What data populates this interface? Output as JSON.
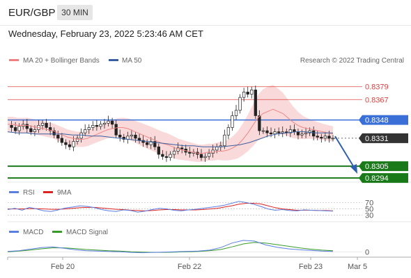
{
  "header": {
    "pair": "EUR/GBP",
    "timeframe": "30 MIN",
    "datetime": "Wednesday, February 23, 2022 5:23:46 AM CET"
  },
  "legend": {
    "ma20": "MA 20 + Bollinger Bands",
    "ma50": "MA 50",
    "credit": "Research © 2022 Trading Central"
  },
  "colors": {
    "resistance": "#d44",
    "pivot": "#3a6fd8",
    "support": "#1a7a1a",
    "price": "#333333",
    "bollinger": "#f6c9c9",
    "ma20": "#e88",
    "ma50": "#3a5fa0",
    "rsi": "#5a7de0",
    "rsi_ma": "#d22",
    "macd": "#5a7de0",
    "macd_signal": "#3a9a2a",
    "arrow": "#2d5fb0"
  },
  "chart_data": [
    {
      "type": "candlestick",
      "title": "EUR/GBP 30 MIN",
      "x_tick_labels": [
        "Feb 20",
        "Feb 22",
        "Feb 23",
        "Mar 5"
      ],
      "ylim": [
        0.8285,
        0.8395
      ],
      "levels": [
        {
          "value": 0.8379,
          "label": "0.8379",
          "kind": "resistance"
        },
        {
          "value": 0.8367,
          "label": "0.8367",
          "kind": "resistance"
        },
        {
          "value": 0.8348,
          "label": "0.8348",
          "kind": "pivot"
        },
        {
          "value": 0.8331,
          "label": "0.8331",
          "kind": "last-price"
        },
        {
          "value": 0.8305,
          "label": "0.8305",
          "kind": "support"
        },
        {
          "value": 0.8294,
          "label": "0.8294",
          "kind": "support"
        }
      ],
      "series": [
        {
          "name": "MA 20 + Bollinger Bands"
        },
        {
          "name": "MA 50"
        }
      ],
      "close": [
        0.8343,
        0.8341,
        0.8338,
        0.8342,
        0.8344,
        0.834,
        0.8337,
        0.8339,
        0.8343,
        0.8345,
        0.8341,
        0.8338,
        0.8334,
        0.8331,
        0.8327,
        0.8325,
        0.8323,
        0.8328,
        0.8331,
        0.8336,
        0.8339,
        0.8341,
        0.8343,
        0.8342,
        0.8344,
        0.8345,
        0.8347,
        0.8344,
        0.8334,
        0.8332,
        0.833,
        0.8333,
        0.8334,
        0.8331,
        0.8329,
        0.8327,
        0.8325,
        0.8328,
        0.8323,
        0.8316,
        0.8314,
        0.8313,
        0.8316,
        0.8319,
        0.8322,
        0.8321,
        0.8318,
        0.8317,
        0.8318,
        0.8316,
        0.8313,
        0.8314,
        0.8317,
        0.832,
        0.8323,
        0.8324,
        0.8334,
        0.8341,
        0.8352,
        0.8357,
        0.8369,
        0.8374,
        0.8372,
        0.8376,
        0.8352,
        0.8338,
        0.8338,
        0.8336,
        0.8335,
        0.8337,
        0.8336,
        0.8337,
        0.8336,
        0.8339,
        0.8337,
        0.8334,
        0.8335,
        0.8336,
        0.8338,
        0.8333,
        0.8332,
        0.8331,
        0.8333,
        0.8331,
        0.8331
      ],
      "ma20_approx": [
        0.8344,
        0.8344,
        0.8343,
        0.8343,
        0.8343,
        0.8342,
        0.8341,
        0.834,
        0.8339,
        0.8338,
        0.8336,
        0.8334,
        0.8332,
        0.8331,
        0.833,
        0.833,
        0.8331,
        0.8333,
        0.8335,
        0.8337,
        0.8339,
        0.834,
        0.8341,
        0.8341,
        0.834,
        0.8338,
        0.8336,
        0.8334,
        0.8332,
        0.833,
        0.8328,
        0.8326,
        0.8325,
        0.8323,
        0.8321,
        0.832,
        0.8319,
        0.8318,
        0.8317,
        0.8317,
        0.8318,
        0.8318,
        0.8319,
        0.8319,
        0.832,
        0.8322,
        0.8325,
        0.833,
        0.8336,
        0.8343,
        0.835,
        0.8354,
        0.8356,
        0.8358,
        0.8356,
        0.8354,
        0.835,
        0.8346,
        0.8343,
        0.8341,
        0.834,
        0.8339,
        0.8338,
        0.8337,
        0.8336,
        0.8335
      ],
      "ma50_approx": [
        0.8337,
        0.8336,
        0.8336,
        0.8335,
        0.8335,
        0.8335,
        0.8335,
        0.8334,
        0.8334,
        0.8333,
        0.8333,
        0.8332,
        0.8331,
        0.833,
        0.8329,
        0.8328,
        0.8327,
        0.8326,
        0.8325,
        0.8324,
        0.8324,
        0.8323,
        0.8323,
        0.8323,
        0.8324,
        0.8325,
        0.8327,
        0.833,
        0.8333,
        0.8335,
        0.8336,
        0.8337,
        0.8337,
        0.8336,
        0.8336,
        0.8336
      ]
    },
    {
      "type": "line",
      "title": "RSI",
      "series": [
        {
          "name": "RSI"
        },
        {
          "name": "9MA"
        }
      ],
      "y_tick_labels": [
        "70",
        "50",
        "30"
      ],
      "rsi": [
        48,
        52,
        46,
        55,
        50,
        44,
        42,
        47,
        53,
        56,
        60,
        58,
        54,
        48,
        44,
        42,
        47,
        45,
        40,
        43,
        48,
        52,
        50,
        46,
        44,
        47,
        49,
        52,
        55,
        58,
        62,
        68,
        74,
        70,
        65,
        58,
        50,
        46,
        48,
        45,
        44,
        47,
        46,
        45,
        44,
        43
      ],
      "rsi_9ma": [
        50,
        50,
        50,
        51,
        51,
        50,
        49,
        49,
        50,
        52,
        54,
        55,
        55,
        53,
        51,
        49,
        48,
        46,
        45,
        44,
        45,
        47,
        48,
        48,
        47,
        47,
        47,
        48,
        50,
        52,
        56,
        60,
        65,
        68,
        68,
        66,
        60,
        54,
        50,
        48,
        46,
        46,
        46,
        45,
        45,
        44
      ]
    },
    {
      "type": "line",
      "title": "MACD",
      "series": [
        {
          "name": "MACD"
        },
        {
          "name": "MACD Signal"
        }
      ],
      "y_tick_labels": [
        "0"
      ],
      "macd": [
        0.2,
        0.4,
        0.9,
        1.4,
        1.6,
        1.2,
        0.7,
        0.4,
        0.3,
        0.2,
        0.1,
        -0.1,
        -0.2,
        -0.1,
        0.0,
        0.1,
        0.2,
        0.3,
        0.6,
        1.4,
        2.8,
        3.6,
        3.4,
        2.2,
        1.5,
        1.0,
        0.7,
        0.5,
        0.3,
        0.2
      ],
      "macd_signal": [
        0.1,
        0.3,
        0.6,
        1.0,
        1.3,
        1.3,
        1.1,
        0.8,
        0.6,
        0.4,
        0.3,
        0.1,
        0.0,
        -0.1,
        -0.1,
        0.0,
        0.1,
        0.2,
        0.4,
        0.8,
        1.6,
        2.5,
        3.0,
        2.8,
        2.3,
        1.8,
        1.3,
        0.9,
        0.6,
        0.4
      ]
    }
  ]
}
